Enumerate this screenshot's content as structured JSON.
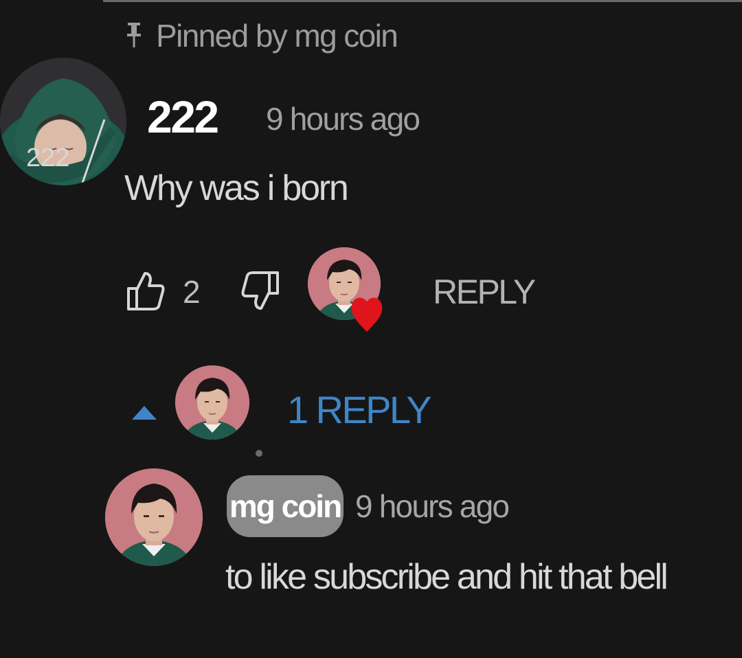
{
  "pinned": {
    "label": "Pinned by mg coin",
    "icon": "pin-icon"
  },
  "comment": {
    "author": "222",
    "timestamp": "9 hours ago",
    "text": "Why was i born",
    "avatar_text": "222",
    "likes": "2",
    "reply_label": "REPLY",
    "creator_heart": true
  },
  "replies_toggle": {
    "label": "1 REPLY",
    "icon": "caret-up-icon",
    "color": "#3f86c7"
  },
  "reply": {
    "author": "mg coin",
    "timestamp": "9 hours ago",
    "text": "to like subscribe and hit that bell"
  },
  "colors": {
    "background": "#161616",
    "heart": "#e0141c",
    "owner_chip": "#8a8a8a"
  }
}
